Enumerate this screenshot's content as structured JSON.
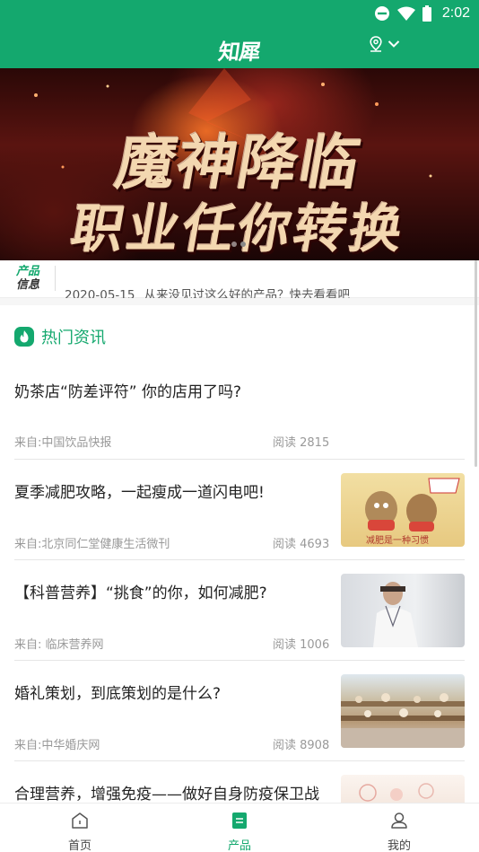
{
  "status_bar": {
    "time": "2:02"
  },
  "header": {
    "logo": "知犀"
  },
  "banner": {
    "line1": "魔神降临",
    "line2": "职业任你转换",
    "slide_count": 2,
    "active_slide": 2
  },
  "notice": {
    "badge_line1": "产品",
    "badge_line2": "信息",
    "date": "2020-05-15",
    "text": "从来没见过这么好的产品？快去看看吧"
  },
  "section": {
    "title": "热门资讯"
  },
  "news": [
    {
      "title": "奶茶店“防差评符” 你的店用了吗?",
      "source": "来自:中国饮品快报",
      "reads": "阅读 2815",
      "thumb": null
    },
    {
      "title": "夏季减肥攻略，一起瘦成一道闪电吧!",
      "source": "来自:北京同仁堂健康生活微刊",
      "reads": "阅读 4693",
      "thumb": "cartoon",
      "thumb_caption": "减肥是一种习惯"
    },
    {
      "title": "【科普营养】“挑食”的你，如何减肥?",
      "source": "来自: 临床营养网",
      "reads": "阅读 1006",
      "thumb": "doctor"
    },
    {
      "title": "婚礼策划，到底策划的是什么?",
      "source": "来自:中华婚庆网",
      "reads": "阅读 8908",
      "thumb": "wedding"
    },
    {
      "title": "合理营养，增强免疫——做好自身防疫保卫战",
      "source": "",
      "reads": "",
      "thumb": "food"
    }
  ],
  "tabs": [
    {
      "label": "首页",
      "icon": "home-icon",
      "active": false
    },
    {
      "label": "产品",
      "icon": "product-icon",
      "active": true
    },
    {
      "label": "我的",
      "icon": "profile-icon",
      "active": false
    }
  ],
  "colors": {
    "brand": "#14a86e",
    "text": "#222222",
    "muted": "#999999"
  }
}
